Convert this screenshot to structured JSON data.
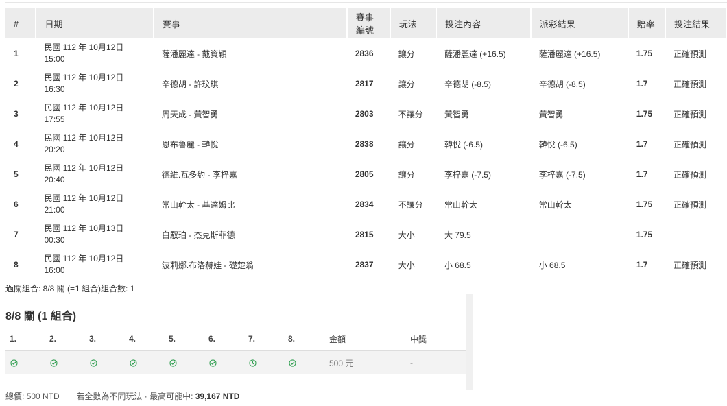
{
  "table": {
    "headers": [
      "#",
      "日期",
      "賽事",
      "賽事編號",
      "玩法",
      "投注內容",
      "派彩結果",
      "賠率",
      "投注結果"
    ],
    "rows": [
      {
        "idx": "1",
        "date": "民國 112 年 10月12日",
        "time": "15:00",
        "event": "薩潘麗達 - 戴資穎",
        "id": "2836",
        "play": "讓分",
        "content": "薩潘麗達 (+16.5)",
        "result": "薩潘麗達 (+16.5)",
        "odds": "1.75",
        "outcome": "正確預測"
      },
      {
        "idx": "2",
        "date": "民國 112 年 10月12日",
        "time": "16:30",
        "event": "辛德胡 - 許玟琪",
        "id": "2817",
        "play": "讓分",
        "content": "辛德胡 (-8.5)",
        "result": "辛德胡 (-8.5)",
        "odds": "1.7",
        "outcome": "正確預測"
      },
      {
        "idx": "3",
        "date": "民國 112 年 10月12日",
        "time": "17:55",
        "event": "周天成 - 黃智勇",
        "id": "2803",
        "play": "不讓分",
        "content": "黃智勇",
        "result": "黃智勇",
        "odds": "1.75",
        "outcome": "正確預測"
      },
      {
        "idx": "4",
        "date": "民國 112 年 10月12日",
        "time": "20:20",
        "event": "恩布魯麗 - 韓悅",
        "id": "2838",
        "play": "讓分",
        "content": "韓悅 (-6.5)",
        "result": "韓悅 (-6.5)",
        "odds": "1.7",
        "outcome": "正確預測"
      },
      {
        "idx": "5",
        "date": "民國 112 年 10月12日",
        "time": "20:40",
        "event": "德維.瓦多約 - 李梓嘉",
        "id": "2805",
        "play": "讓分",
        "content": "李梓嘉 (-7.5)",
        "result": "李梓嘉 (-7.5)",
        "odds": "1.7",
        "outcome": "正確預測"
      },
      {
        "idx": "6",
        "date": "民國 112 年 10月12日",
        "time": "21:00",
        "event": "常山幹太 - 基達姆比",
        "id": "2834",
        "play": "不讓分",
        "content": "常山幹太",
        "result": "常山幹太",
        "odds": "1.75",
        "outcome": "正確預測"
      },
      {
        "idx": "7",
        "date": "民國 112 年 10月13日",
        "time": "00:30",
        "event": "白馭珀 - 杰克斯菲德",
        "id": "2815",
        "play": "大小",
        "content": "大 79.5",
        "result": "",
        "odds": "1.75",
        "outcome": ""
      },
      {
        "idx": "8",
        "date": "民國 112 年 10月12日",
        "time": "16:00",
        "event": "波莉娜.布洛赫娃 - 礎楚翁",
        "id": "2837",
        "play": "大小",
        "content": "小 68.5",
        "result": "小 68.5",
        "odds": "1.7",
        "outcome": "正確預測"
      }
    ]
  },
  "combo_summary": "過關組合: 8/8 關 (=1 組合)組合數: 1",
  "combo_title": "8/8 關 (1 組合)",
  "parlay": {
    "legs": [
      "1.",
      "2.",
      "3.",
      "4.",
      "5.",
      "6.",
      "7.",
      "8."
    ],
    "amount_label": "金額",
    "win_label": "中獎",
    "statuses": [
      "check-icon",
      "check-icon",
      "check-icon",
      "check-icon",
      "check-icon",
      "check-icon",
      "clock-icon",
      "check-icon"
    ],
    "amount_value": "500 元",
    "win_value": "-"
  },
  "footer": {
    "total_label": "總價:",
    "total_value": "500 NTD",
    "note": "若全數為不同玩法 · 最高可能中:",
    "max_win": "39,167 NTD"
  },
  "colors": {
    "check": "#2e9e4f",
    "clock": "#2e9e4f",
    "header_bg": "#ececec"
  }
}
